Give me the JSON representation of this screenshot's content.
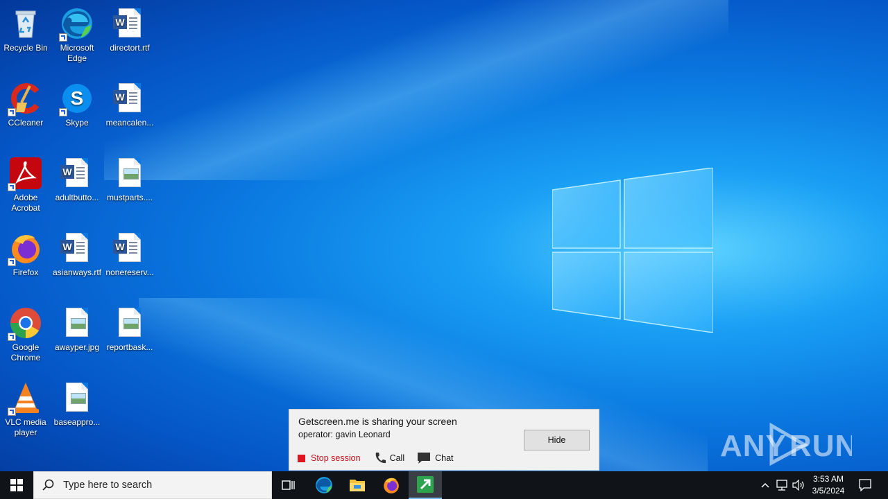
{
  "desktop": {
    "icons": [
      {
        "label": "Recycle Bin",
        "icon": "recycle-bin-icon"
      },
      {
        "label": "Microsoft Edge",
        "icon": "edge-icon"
      },
      {
        "label": "directort.rtf",
        "icon": "word-document-icon"
      },
      {
        "label": "CCleaner",
        "icon": "ccleaner-icon"
      },
      {
        "label": "Skype",
        "icon": "skype-icon"
      },
      {
        "label": "meancalen...",
        "icon": "word-document-icon"
      },
      {
        "label": "Adobe Acrobat",
        "icon": "acrobat-icon"
      },
      {
        "label": "adultbutto...",
        "icon": "word-document-icon"
      },
      {
        "label": "mustparts....",
        "icon": "image-file-icon"
      },
      {
        "label": "Firefox",
        "icon": "firefox-icon"
      },
      {
        "label": "asianways.rtf",
        "icon": "word-document-icon"
      },
      {
        "label": "nonereserv...",
        "icon": "word-document-icon"
      },
      {
        "label": "Google Chrome",
        "icon": "chrome-icon"
      },
      {
        "label": "awayper.jpg",
        "icon": "image-file-icon"
      },
      {
        "label": "reportbask...",
        "icon": "image-file-icon"
      },
      {
        "label": "VLC media player",
        "icon": "vlc-icon"
      },
      {
        "label": "baseappro...",
        "icon": "image-file-icon"
      }
    ]
  },
  "notification": {
    "title": "Getscreen.me is sharing your screen",
    "operator": "operator: gavin Leonard",
    "stop_label": "Stop session",
    "call_label": "Call",
    "chat_label": "Chat",
    "hide_label": "Hide"
  },
  "watermark": {
    "text": "ANY RUN"
  },
  "taskbar": {
    "search_placeholder": "Type here to search",
    "pinned": [
      "task-view-icon",
      "edge-icon",
      "file-explorer-icon",
      "firefox-icon",
      "getscreen-icon"
    ],
    "clock_time": "3:53 AM",
    "clock_date": "3/5/2024"
  },
  "colors": {
    "taskbar": "#101418",
    "accent_stop": "#e0141e",
    "panel_bg": "#f1f1f1"
  }
}
